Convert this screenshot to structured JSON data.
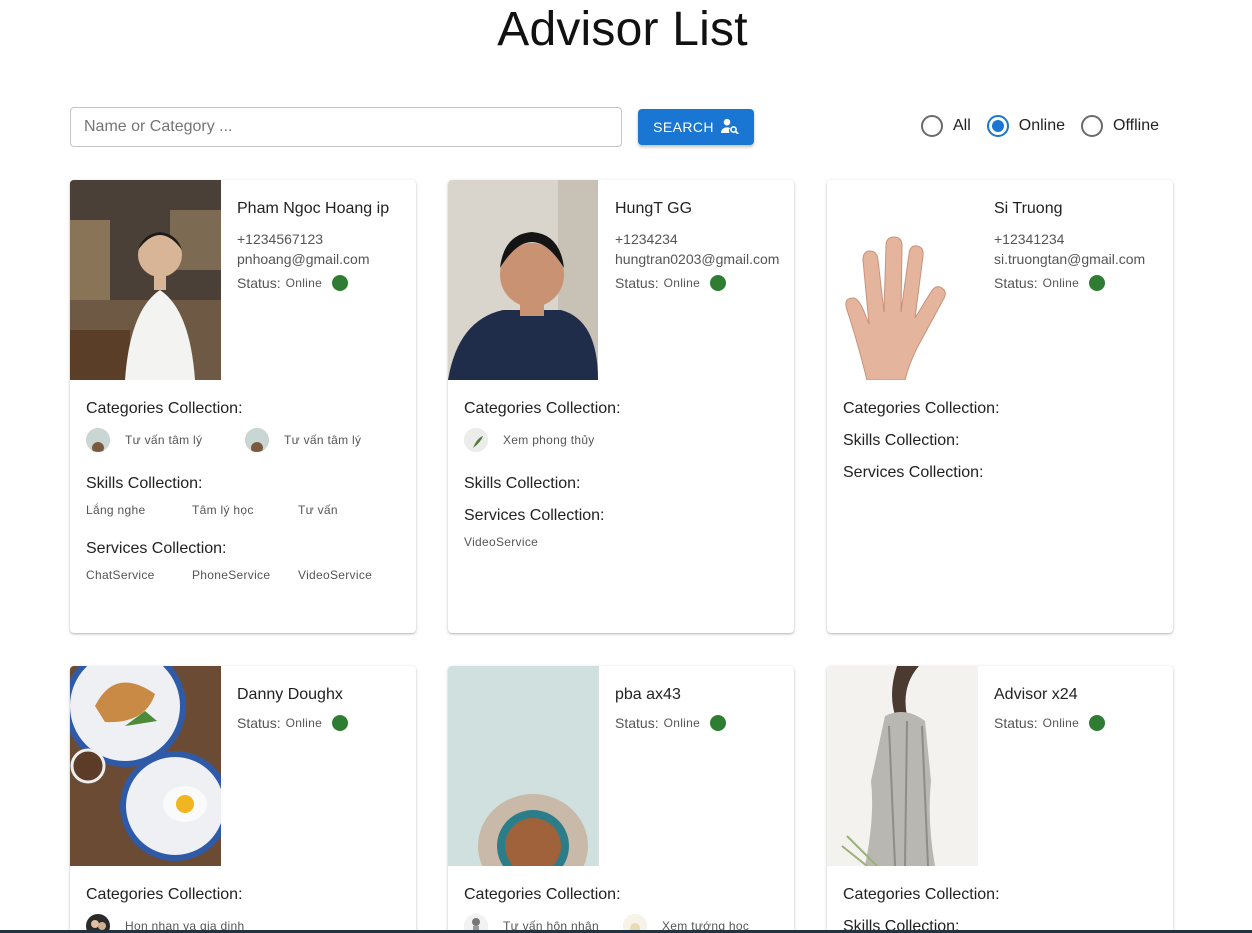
{
  "page": {
    "title": "Advisor List"
  },
  "search": {
    "placeholder": "Name or Category ...",
    "value": "",
    "button_label": "SEARCH"
  },
  "filter": {
    "options": [
      {
        "label": "All",
        "checked": false
      },
      {
        "label": "Online",
        "checked": true
      },
      {
        "label": "Offline",
        "checked": false
      }
    ]
  },
  "labels": {
    "status": "Status:",
    "categories": "Categories Collection:",
    "skills": "Skills Collection:",
    "services": "Services Collection:"
  },
  "advisors": [
    {
      "name": "Pham Ngoc Hoang ip",
      "phone": "+1234567123",
      "email": "pnhoang@gmail.com",
      "status": "Online",
      "categories": [
        "Tư vấn tâm lý",
        "Tư vấn tâm lý"
      ],
      "skills": [
        "Lắng nghe",
        "Tâm lý học",
        "Tư vấn"
      ],
      "services": [
        "ChatService",
        "PhoneService",
        "VideoService"
      ]
    },
    {
      "name": "HungT GG",
      "phone": "+1234234",
      "email": "hungtran0203@gmail.com",
      "status": "Online",
      "categories": [
        "Xem phong thủy"
      ],
      "skills": [],
      "services": [
        "VideoService"
      ]
    },
    {
      "name": "Si Truong",
      "phone": "+12341234",
      "email": "si.truongtan@gmail.com",
      "status": "Online",
      "categories": [],
      "skills": [],
      "services": []
    },
    {
      "name": "Danny Doughx",
      "status": "Online",
      "categories": [
        "Hon nhan va gia dinh"
      ]
    },
    {
      "name": "pba ax43",
      "status": "Online",
      "categories": [
        "Tư vấn hôn nhân",
        "Xem tướng học"
      ]
    },
    {
      "name": "Advisor x24",
      "status": "Online",
      "categories": []
    }
  ],
  "colors": {
    "primary": "#1976d2",
    "online": "#2e7d32"
  }
}
